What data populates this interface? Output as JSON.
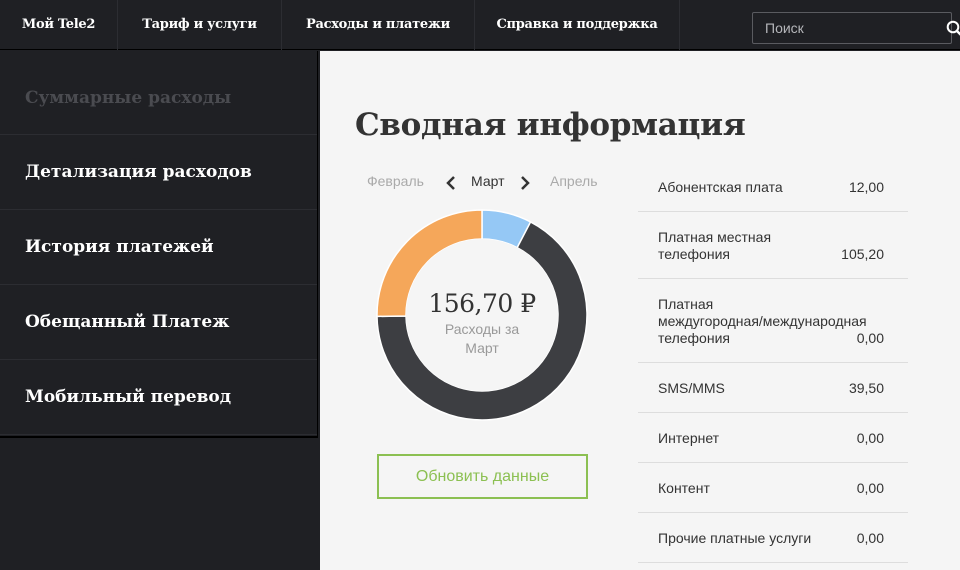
{
  "nav": {
    "items": [
      "Мой Tele2",
      "Тариф и услуги",
      "Расходы и платежи",
      "Справка и поддержка"
    ],
    "search_placeholder": "Поиск"
  },
  "sidebar": {
    "items": [
      "Суммарные расходы",
      "Детализация расходов",
      "История платежей",
      "Обещанный Платеж",
      "Мобильный перевод"
    ]
  },
  "main": {
    "title": "Сводная информация",
    "month_nav": {
      "prev": "Февраль",
      "current": "Март",
      "next": "Апрель"
    },
    "donut": {
      "total": "156,70 ₽",
      "caption_line1": "Расходы за",
      "caption_line2": "Март",
      "segments": [
        {
          "label": "Абонентская плата",
          "value": 12.0,
          "color": "#95c8f5"
        },
        {
          "label": "Платная местная телефония",
          "value": 105.2,
          "color": "#3d3e42"
        },
        {
          "label": "SMS/MMS",
          "value": 39.5,
          "color": "#f5a75a"
        }
      ]
    },
    "refresh_label": "Обновить данные",
    "expenses": [
      {
        "lines": [
          "Абонентская плата"
        ],
        "amount": "12,00"
      },
      {
        "lines": [
          "Платная местная",
          "телефония"
        ],
        "amount": "105,20"
      },
      {
        "lines": [
          "Платная",
          "междугородная/международная",
          "телефония"
        ],
        "amount": "0,00"
      },
      {
        "lines": [
          "SMS/MMS"
        ],
        "amount": "39,50"
      },
      {
        "lines": [
          "Интернет"
        ],
        "amount": "0,00"
      },
      {
        "lines": [
          "Контент"
        ],
        "amount": "0,00"
      },
      {
        "lines": [
          "Прочие платные услуги"
        ],
        "amount": "0,00"
      }
    ]
  }
}
